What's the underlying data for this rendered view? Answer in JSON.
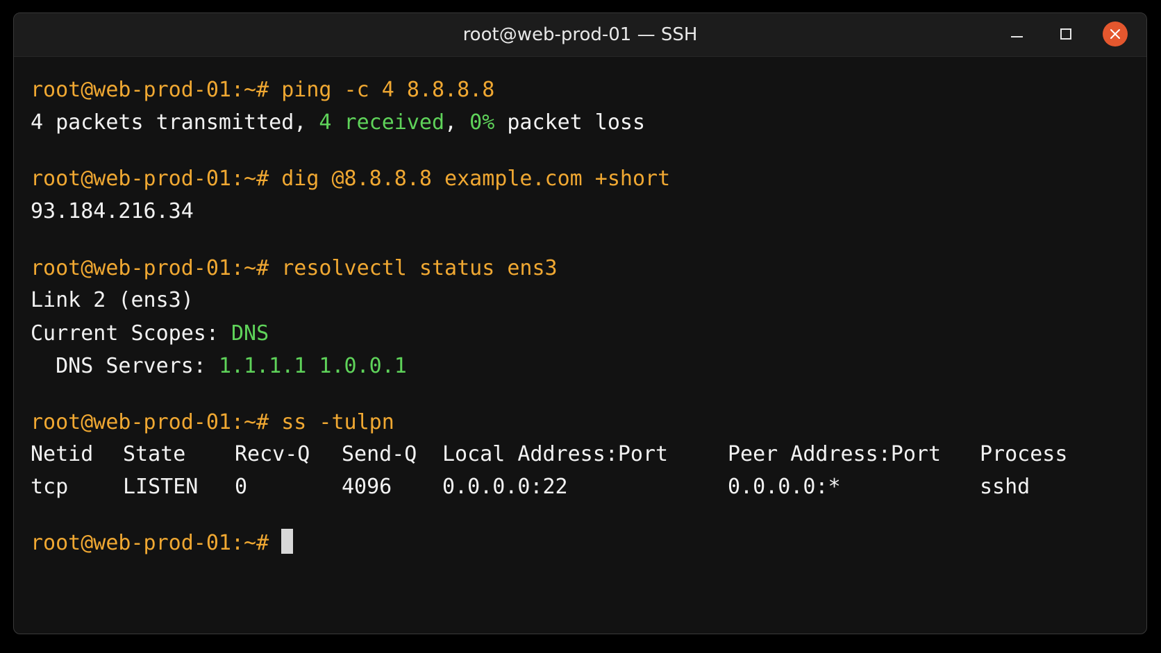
{
  "window": {
    "title": "root@web-prod-01 — SSH"
  },
  "prompt": "root@web-prod-01:~# ",
  "blocks": {
    "ping": {
      "command": "ping -c 4 8.8.8.8",
      "out_a": "4 packets transmitted, ",
      "out_b": "4 received",
      "out_c": ", ",
      "out_d": "0%",
      "out_e": " packet loss"
    },
    "dig": {
      "command": "dig @8.8.8.8 example.com +short",
      "output": "93.184.216.34"
    },
    "resolvectl": {
      "command": "resolvectl status ens3",
      "link": "Link 2 (ens3)",
      "scopes_label": "Current Scopes: ",
      "scopes_value": "DNS",
      "servers_label": "  DNS Servers: ",
      "servers_value": "1.1.1.1 1.0.0.1"
    },
    "ss": {
      "command": "ss -tulpn",
      "headers": [
        "Netid",
        "State",
        "Recv-Q",
        "Send-Q",
        "Local Address:Port",
        "Peer Address:Port",
        "Process"
      ],
      "rows": [
        [
          "tcp",
          "LISTEN",
          "0",
          "4096",
          "0.0.0.0:22",
          "0.0.0.0:*",
          "sshd"
        ]
      ]
    }
  },
  "colors": {
    "prompt": "#f0a832",
    "highlight": "#5fd35a",
    "text": "#f2f2f2",
    "background": "#121212",
    "close_button": "#e4572e"
  },
  "icons": {
    "minimize": "minimize-icon",
    "maximize": "maximize-icon",
    "close": "close-icon"
  }
}
